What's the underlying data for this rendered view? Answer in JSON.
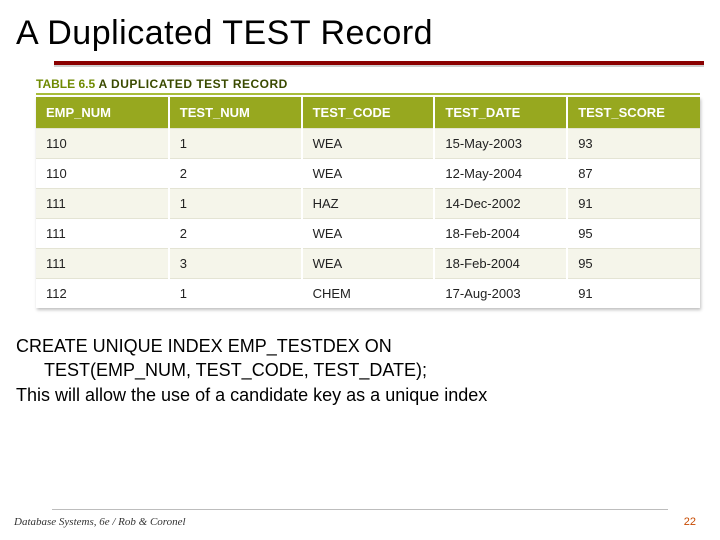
{
  "title": "A Duplicated TEST Record",
  "table_label": {
    "prefix": "TABLE",
    "num": "6.5",
    "desc": "A DUPLICATED TEST RECORD"
  },
  "columns": [
    "EMP_NUM",
    "TEST_NUM",
    "TEST_CODE",
    "TEST_DATE",
    "TEST_SCORE"
  ],
  "rows": [
    {
      "emp_num": "110",
      "test_num": "1",
      "test_code": "WEA",
      "test_date": "15-May-2003",
      "test_score": "93"
    },
    {
      "emp_num": "110",
      "test_num": "2",
      "test_code": "WEA",
      "test_date": "12-May-2004",
      "test_score": "87"
    },
    {
      "emp_num": "111",
      "test_num": "1",
      "test_code": "HAZ",
      "test_date": "14-Dec-2002",
      "test_score": "91"
    },
    {
      "emp_num": "111",
      "test_num": "2",
      "test_code": "WEA",
      "test_date": "18-Feb-2004",
      "test_score": "95"
    },
    {
      "emp_num": "111",
      "test_num": "3",
      "test_code": "WEA",
      "test_date": "18-Feb-2004",
      "test_score": "95"
    },
    {
      "emp_num": "112",
      "test_num": "1",
      "test_code": "CHEM",
      "test_date": "17-Aug-2003",
      "test_score": "91"
    }
  ],
  "body": {
    "line1": "CREATE UNIQUE INDEX EMP_TESTDEX ON",
    "line2": "TEST(EMP_NUM, TEST_CODE, TEST_DATE);",
    "line3": "This will allow the use of a candidate key as a unique index"
  },
  "footer": {
    "left": "Database Systems, 6e / Rob & Coronel",
    "right": "22"
  }
}
